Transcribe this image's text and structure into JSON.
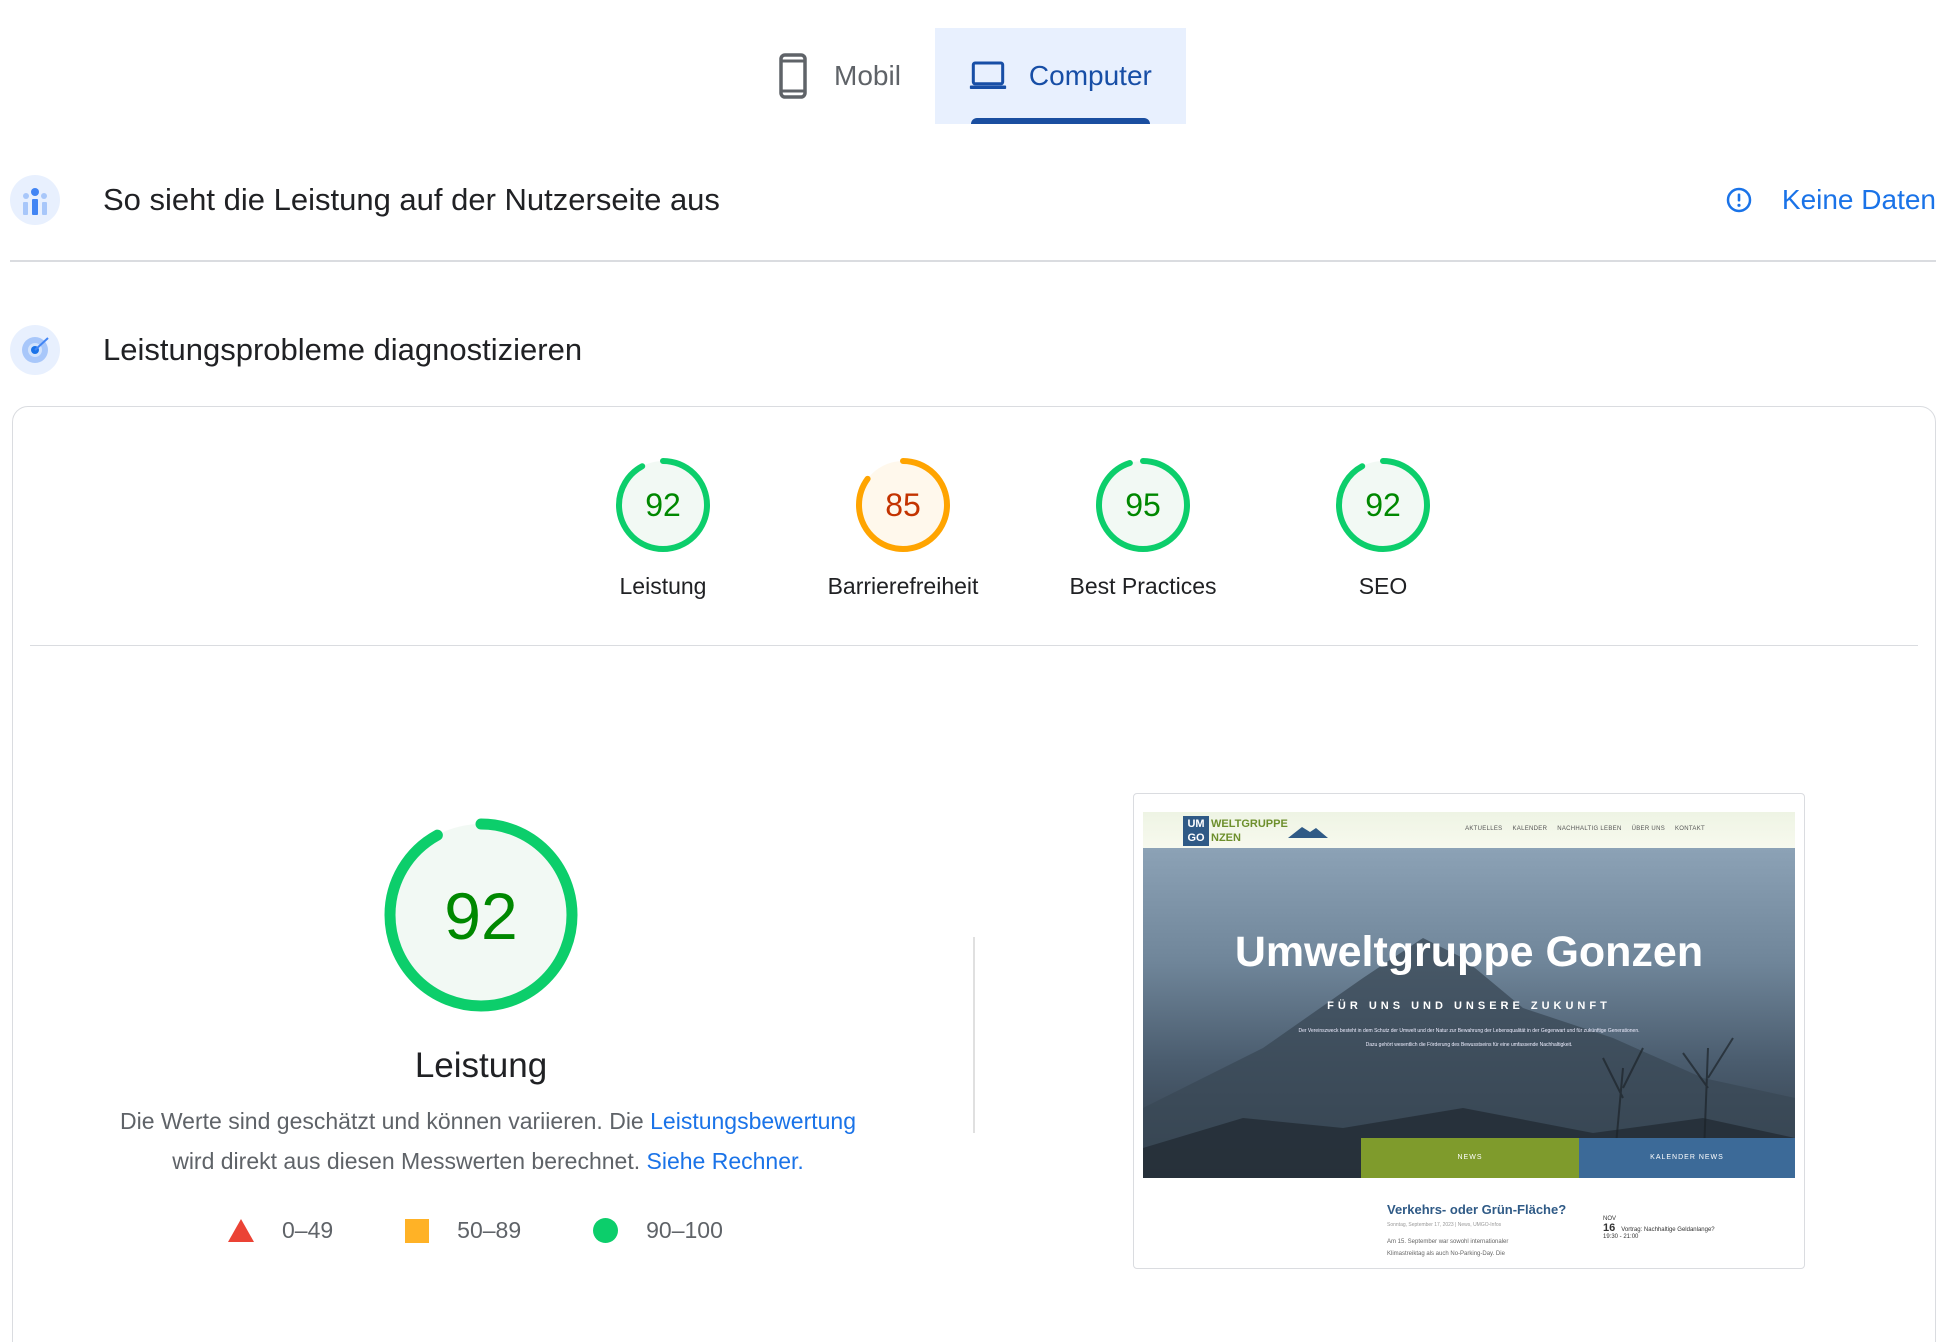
{
  "tabs": [
    {
      "label": "Mobil",
      "icon": "smartphone-icon",
      "active": false
    },
    {
      "label": "Computer",
      "icon": "laptop-icon",
      "active": true
    }
  ],
  "field_data": {
    "title": "So sieht die Leistung auf der Nutzerseite aus",
    "status_link": "Keine Daten"
  },
  "diagnostics": {
    "title": "Leistungsprobleme diagnostizieren"
  },
  "scores": [
    {
      "label": "Leistung",
      "value": 92,
      "rating": "pass"
    },
    {
      "label": "Barrierefreiheit",
      "value": 85,
      "rating": "average"
    },
    {
      "label": "Best Practices",
      "value": 95,
      "rating": "pass"
    },
    {
      "label": "SEO",
      "value": 92,
      "rating": "pass"
    }
  ],
  "performance": {
    "score": 92,
    "label": "Leistung",
    "desc_part1": "Die Werte sind geschätzt und können variieren. Die ",
    "desc_link1": "Leistungsbewertung",
    "desc_part2": " wird direkt aus diesen Messwerten berechnet. ",
    "desc_link2": "Siehe Rechner",
    "desc_part3": "."
  },
  "legend": [
    {
      "shape": "triangle",
      "range": "0–49",
      "color": "#eb4335"
    },
    {
      "shape": "square",
      "range": "50–89",
      "color": "#ffa400"
    },
    {
      "shape": "circle",
      "range": "90–100",
      "color": "#0cce6b"
    }
  ],
  "colors": {
    "pass_ring": "#0cce6b",
    "pass_text": "#008800",
    "pass_fill": "#e6f4ea",
    "average_ring": "#ffa400",
    "average_text": "#c33300",
    "average_fill": "#fff3e0",
    "link": "#1a73e8",
    "active_tab_bg": "#e8f0fe"
  },
  "screenshot": {
    "logo_box": "UM GO",
    "logo_text_1": "WELTGRUPPE",
    "logo_text_2": "NZEN",
    "nav": [
      "AKTUELLES",
      "KALENDER",
      "NACHHALTIG LEBEN",
      "ÜBER UNS",
      "KONTAKT"
    ],
    "hero_title": "Umweltgruppe Gonzen",
    "hero_subtitle": "FÜR UNS UND UNSERE ZUKUNFT",
    "hero_text": "Der Vereinszweck besteht in dem Schutz der Umwelt und der Natur zur Bewahrung der Lebensqualität in der Gegenwart und für zukünftige Generationen. Dazu gehört wesentlich die Förderung des Bewusstseins für eine umfassende Nachhaltigkeit.",
    "button_news": "NEWS",
    "button_calendar": "KALENDER NEWS",
    "post_title": "Verkehrs- oder Grün-Fläche?",
    "post_meta": "Sonntag, September 17, 2023 | News, UMGO-Infos",
    "post_text": "Am 15. September war sowohl internationaler Klimastreiktag als auch No-Parking-Day. Die",
    "cal_month": "NOV",
    "cal_day": "16",
    "cal_time": "19:30 - 21:00",
    "cal_event": "Vortrag: Nachhaltige Geldanlange?"
  }
}
